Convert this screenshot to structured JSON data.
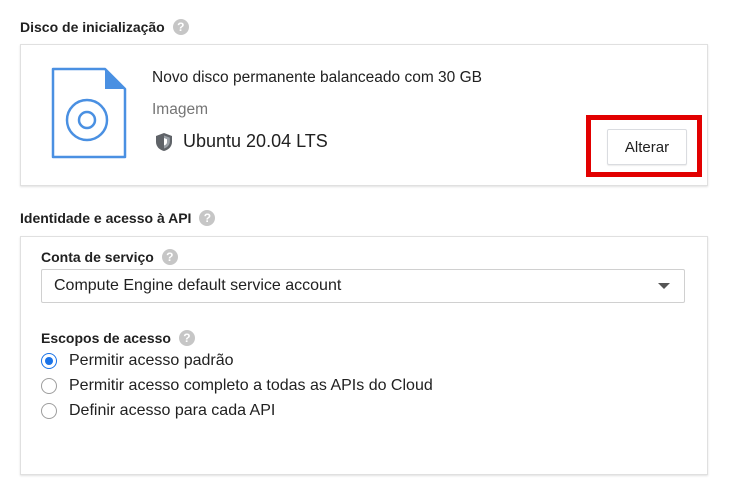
{
  "boot_disk": {
    "title": "Disco de inicialização",
    "help": "?",
    "description": "Novo disco permanente balanceado com 30 GB",
    "image_label": "Imagem",
    "os_name": "Ubuntu 20.04 LTS",
    "change_label": "Alterar",
    "icons": {
      "disk": "disk-file-icon",
      "os": "shield-icon"
    }
  },
  "identity": {
    "title": "Identidade e acesso à API",
    "help": "?",
    "service_account": {
      "label": "Conta de serviço",
      "help": "?",
      "value": "Compute Engine default service account"
    },
    "scopes": {
      "label": "Escopos de acesso",
      "help": "?",
      "options": [
        {
          "label": "Permitir acesso padrão",
          "selected": true
        },
        {
          "label": "Permitir acesso completo a todas as APIs do Cloud",
          "selected": false
        },
        {
          "label": "Definir acesso para cada API",
          "selected": false
        }
      ]
    }
  },
  "colors": {
    "accent": "#1a73e8",
    "highlight": "#e20000"
  }
}
